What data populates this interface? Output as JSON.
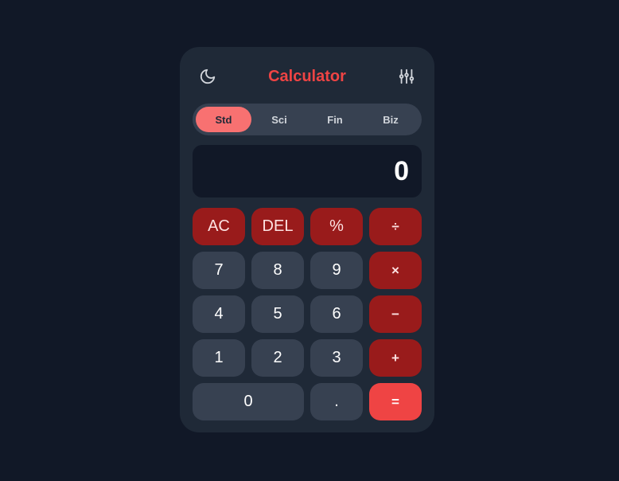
{
  "header": {
    "title": "Calculator",
    "theme_icon": "moon-icon",
    "settings_icon": "sliders-icon"
  },
  "tabs": [
    {
      "label": "Std",
      "active": true
    },
    {
      "label": "Sci",
      "active": false
    },
    {
      "label": "Fin",
      "active": false
    },
    {
      "label": "Biz",
      "active": false
    }
  ],
  "display": {
    "value": "0"
  },
  "keys": {
    "ac": "AC",
    "del": "DEL",
    "percent": "%",
    "divide": "÷",
    "seven": "7",
    "eight": "8",
    "nine": "9",
    "multiply": "×",
    "four": "4",
    "five": "5",
    "six": "6",
    "subtract": "−",
    "one": "1",
    "two": "2",
    "three": "3",
    "add": "+",
    "zero": "0",
    "decimal": ".",
    "equals": "="
  },
  "colors": {
    "background": "#111827",
    "panel": "#1f2937",
    "accent": "#ef4444",
    "operator": "#991b1b",
    "number_key": "#374151",
    "active_tab": "#f87171"
  }
}
